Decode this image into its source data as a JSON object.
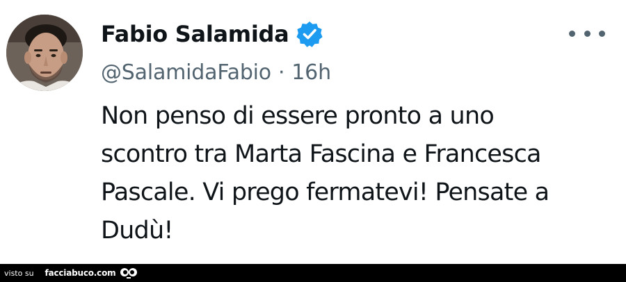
{
  "tweet": {
    "display_name": "Fabio Salamida",
    "handle": "@SalamidaFabio",
    "separator": "·",
    "time": "16h",
    "text_lines": [
      "Non penso di essere pronto a uno",
      "scontro tra Marta Fascina e Francesca",
      "Pascale. Vi prego fermatevi! Pensate a",
      "Dudù!"
    ],
    "verified_icon": "verified-badge-icon",
    "more_icon": "more-options-icon"
  },
  "footer": {
    "prefix": "visto su",
    "brand": "facciabuco.com",
    "logo_icon": "eyes-logo-icon"
  },
  "colors": {
    "text_primary": "#0f1419",
    "text_secondary": "#536471",
    "verified_blue": "#1d9bf0",
    "footer_bg": "#000000"
  }
}
